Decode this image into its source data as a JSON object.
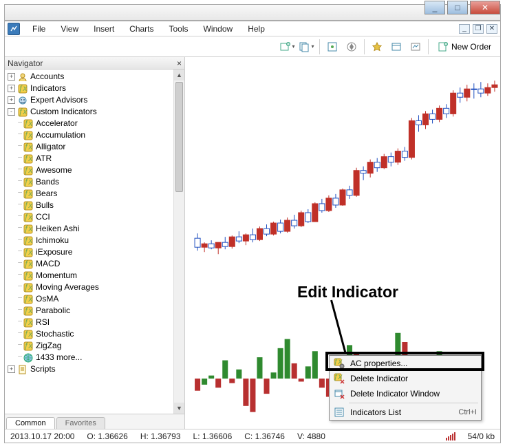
{
  "window": {
    "minimize": "_",
    "maximize": "□",
    "close": "✕",
    "mdi_min": "_",
    "mdi_restore": "❐",
    "mdi_close": "✕"
  },
  "menubar": [
    "File",
    "View",
    "Insert",
    "Charts",
    "Tools",
    "Window",
    "Help"
  ],
  "toolbar": {
    "new_order": "New Order"
  },
  "navigator": {
    "title": "Navigator",
    "roots": [
      {
        "label": "Accounts",
        "icon": "accounts",
        "expander": "+"
      },
      {
        "label": "Indicators",
        "icon": "fx",
        "expander": "+"
      },
      {
        "label": "Expert Advisors",
        "icon": "ea",
        "expander": "+"
      },
      {
        "label": "Custom Indicators",
        "icon": "fx",
        "expander": "-"
      }
    ],
    "custom_indicators": [
      "Accelerator",
      "Accumulation",
      "Alligator",
      "ATR",
      "Awesome",
      "Bands",
      "Bears",
      "Bulls",
      "CCI",
      "Heiken Ashi",
      "Ichimoku",
      "iExposure",
      "MACD",
      "Momentum",
      "Moving Averages",
      "OsMA",
      "Parabolic",
      "RSI",
      "Stochastic",
      "ZigZag"
    ],
    "more_label": "1433 more...",
    "scripts_label": "Scripts",
    "tabs": {
      "common": "Common",
      "favorites": "Favorites"
    }
  },
  "chart_data": {
    "type": "bar",
    "title": "Accelerator Oscillator (context preview)",
    "categories_note": "~40 sequential bars (time axis not labeled)",
    "values": [
      -8,
      -4,
      2,
      -6,
      12,
      -3,
      6,
      -18,
      -22,
      14,
      -10,
      4,
      20,
      26,
      10,
      -2,
      8,
      18,
      -6,
      -12,
      -20,
      14,
      22,
      16,
      12,
      -20,
      -8,
      2,
      8,
      30,
      24,
      -4,
      -22,
      -14,
      10,
      18,
      -6,
      8,
      14,
      -10
    ],
    "series": [
      {
        "name": "up (green)",
        "color": "#2f8a2f"
      },
      {
        "name": "down (red)",
        "color": "#b83030"
      }
    ],
    "ylabel": "",
    "xlabel": "",
    "ylim": [
      -30,
      30
    ]
  },
  "annotation": {
    "label": "Edit Indicator"
  },
  "context_menu": {
    "items": [
      {
        "label": "AC properties...",
        "icon": "fx-gear",
        "highlighted": true
      },
      {
        "label": "Delete Indicator",
        "icon": "fx-del"
      },
      {
        "label": "Delete Indicator Window",
        "icon": "win-del"
      },
      {
        "separator": true
      },
      {
        "label": "Indicators List",
        "icon": "ind-list",
        "shortcut": "Ctrl+I"
      }
    ]
  },
  "statusbar": {
    "datetime": "2013.10.17 20:00",
    "open": "O: 1.36626",
    "high": "H: 1.36793",
    "low": "L: 1.36606",
    "close": "C: 1.36746",
    "volume": "V: 4880",
    "kb": "54/0 kb"
  }
}
